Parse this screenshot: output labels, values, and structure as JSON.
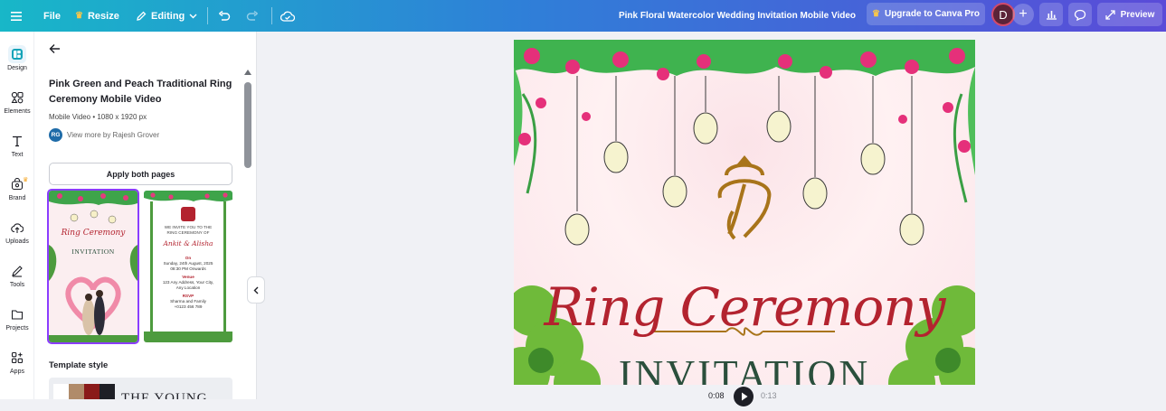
{
  "topbar": {
    "menu_icon": "hamburger-icon",
    "file": "File",
    "resize": "Resize",
    "editing": "Editing",
    "doc_title": "Pink Floral Watercolor Wedding Invitation Mobile Video",
    "upgrade": "Upgrade to Canva Pro",
    "avatar_initial": "D",
    "plus": "+",
    "preview": "Preview"
  },
  "rail": {
    "items": [
      {
        "label": "Design",
        "icon": "design-icon"
      },
      {
        "label": "Elements",
        "icon": "elements-icon"
      },
      {
        "label": "Text",
        "icon": "text-icon"
      },
      {
        "label": "Brand",
        "icon": "brand-icon"
      },
      {
        "label": "Uploads",
        "icon": "uploads-icon"
      },
      {
        "label": "Tools",
        "icon": "tools-icon"
      },
      {
        "label": "Projects",
        "icon": "projects-icon"
      },
      {
        "label": "Apps",
        "icon": "apps-icon"
      }
    ]
  },
  "panel": {
    "title": "Pink Green and Peach Traditional Ring Ceremony Mobile Video",
    "meta": "Mobile Video • 1080 x 1920 px",
    "author_initials": "RG",
    "author": "View more by Rajesh Grover",
    "apply_label": "Apply both pages",
    "template_style_heading": "Template style",
    "style_preview_text": "THE YOUNG",
    "thumb1": {
      "title": "Ring Ceremony",
      "subtitle": "INVITATION"
    },
    "thumb2": {
      "line1": "WE INVITE YOU TO THE",
      "line2": "RING CEREMONY OF",
      "names": "Ankit & Alisha",
      "on": "On",
      "date": "Sunday, 24th August, 2025",
      "time": "08:30 PM Onwards",
      "venue_label": "Venue",
      "venue1": "123 Any Address, Your City,",
      "venue2": "Any Location",
      "rsvp": "RSVP",
      "rsvp_names": "Sharma and Family",
      "phone": "+0123 456 789"
    }
  },
  "canvas": {
    "title": "Ring Ceremony",
    "subtitle": "INVITATION"
  },
  "playback": {
    "current": "0:08",
    "total": "0:13"
  },
  "colors": {
    "accent": "#8b3dff",
    "title_red": "#b3232f",
    "invite_green": "#2a4f3c",
    "gold": "#a8741a"
  }
}
